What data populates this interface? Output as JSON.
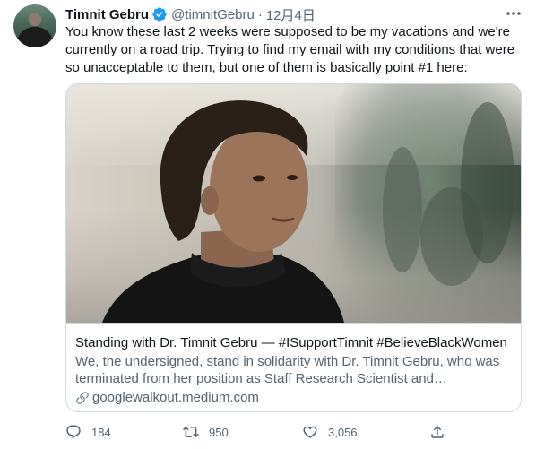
{
  "tweet": {
    "author": {
      "display_name": "Timnit Gebru",
      "handle": "@timnitGebru",
      "verified": true,
      "avatar_icon": "profile-photo"
    },
    "separator": "·",
    "timestamp": "12月4日",
    "text": "You know these last 2 weeks were supposed to be my vacations and we're currently on a road trip. Trying to find my email with my conditions that were so unacceptable to them, but one of them is basically point #1 here:",
    "card": {
      "title": "Standing with Dr. Timnit Gebru — #ISupportTimnit #BelieveBlackWomen",
      "description": "We, the undersigned, stand in solidarity with Dr. Timnit Gebru, who was terminated from her position as Staff Research Scientist and…",
      "domain": "googlewalkout.medium.com"
    },
    "actions": {
      "replies": "184",
      "retweets": "950",
      "likes": "3,056"
    },
    "colors": {
      "verified": "#1d9bf0",
      "secondary_text": "#536471",
      "border": "#cfd9de"
    }
  }
}
